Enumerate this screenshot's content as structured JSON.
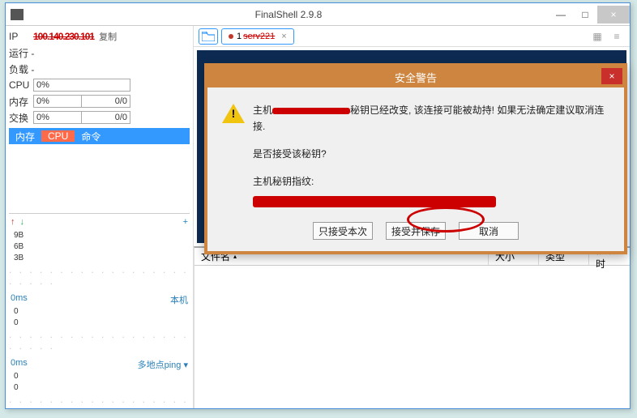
{
  "window": {
    "title": "FinalShell 2.9.8",
    "minimize": "—",
    "maximize": "□",
    "close": "×"
  },
  "sidebar": {
    "ip_label": "IP",
    "ip_value": "100.140.230.101",
    "copy": "复制",
    "run_label": "运行 -",
    "load_label": "负载 -",
    "cpu_label": "CPU",
    "cpu_value": "0%",
    "mem_label": "内存",
    "mem_value": "0%",
    "mem_total": "0/0",
    "swap_label": "交换",
    "swap_value": "0%",
    "swap_total": "0/0",
    "tabs": {
      "mem": "内存",
      "cpu": "CPU",
      "cmd": "命令"
    },
    "net": {
      "y1": "9B",
      "y2": "6B",
      "y3": "3B",
      "plus": "+"
    },
    "ping1": {
      "ms": "0ms",
      "label": "本机",
      "v0": "0",
      "v1": "0"
    },
    "ping2": {
      "ms": "0ms",
      "label": "多地点ping",
      "tri": "▾",
      "v0": "0",
      "v1": "0"
    }
  },
  "tabbar": {
    "tab_index": "1",
    "tab_name": "serv221",
    "close": "×"
  },
  "filepane": {
    "col_name": "文件名",
    "col_size": "大小",
    "col_type": "类型",
    "col_mtime": "修改时",
    "tri": "▴"
  },
  "dialog": {
    "title": "安全警告",
    "close": "×",
    "line1a": "主机",
    "line1b": "秘钥已经改变, 该连接可能被劫持! 如果无法确定建议取消连接.",
    "line2": "是否接受该秘钥?",
    "line3": "主机秘钥指纹:",
    "btn_once": "只接受本次",
    "btn_save": "接受并保存",
    "btn_cancel": "取消"
  }
}
